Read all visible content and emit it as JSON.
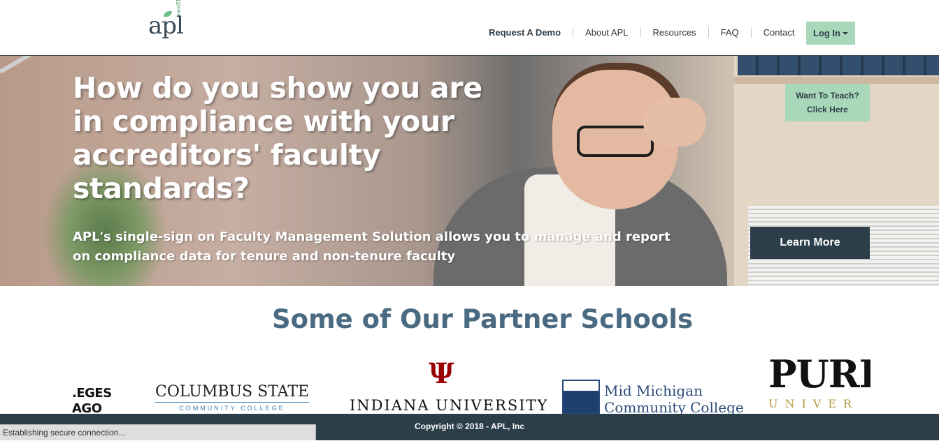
{
  "logo": {
    "text": "apl",
    "sub": "nextED"
  },
  "nav": {
    "items": [
      "Request A Demo",
      "About APL",
      "Resources",
      "FAQ",
      "Contact"
    ],
    "login_label": "Log In"
  },
  "hero": {
    "headline": "How do you show you are in compliance with your accreditors' faculty standards?",
    "subtext": "APL's single-sign on Faculty Management Solution allows you to manage and report on compliance data for tenure and non-tenure faculty",
    "teach_line1": "Want To Teach?",
    "teach_line2": "Click Here",
    "learn_more": "Learn More"
  },
  "partners": {
    "title": "Some of Our Partner Schools",
    "colleges_line1": ".EGES",
    "colleges_line2": "AGO",
    "columbus_name": "COLUMBUS STATE",
    "columbus_sub": "COMMUNITY COLLEGE",
    "iu_name": "INDIANA UNIVERSITY",
    "mmcc_line1": "Mid Michigan",
    "mmcc_line2": "Community College",
    "purdue_name": "PURI",
    "purdue_sub": "UNIVER"
  },
  "footer": {
    "copyright": "Copyright © 2018 - APL, Inc"
  },
  "status": {
    "text": "Establishing secure connection..."
  }
}
